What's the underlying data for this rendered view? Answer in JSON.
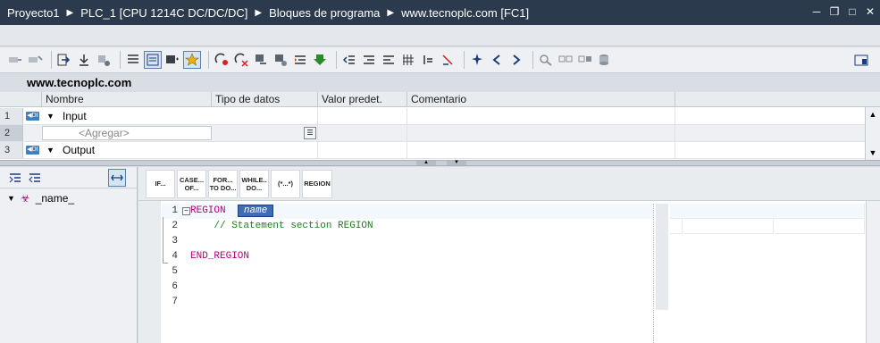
{
  "breadcrumb": [
    "Proyecto1",
    "PLC_1 [CPU 1214C DC/DC/DC]",
    "Bloques de programa",
    "www.tecnoplc.com [FC1]"
  ],
  "block_name": "www.tecnoplc.com",
  "interface": {
    "columns": [
      "Nombre",
      "Tipo de datos",
      "Valor predet.",
      "Comentario"
    ],
    "rows": [
      {
        "num": "1",
        "name": "Input"
      },
      {
        "num": "2",
        "placeholder": "<Agregar>"
      },
      {
        "num": "3",
        "name": "Output"
      }
    ]
  },
  "tree": {
    "node": "_name_"
  },
  "snippets": [
    {
      "l1": "IF...",
      "l2": ""
    },
    {
      "l1": "CASE...",
      "l2": "OF..."
    },
    {
      "l1": "FOR...",
      "l2": "TO DO..."
    },
    {
      "l1": "WHILE..",
      "l2": "DO..."
    },
    {
      "l1": "(*...*)",
      "l2": ""
    },
    {
      "l1": "REGION",
      "l2": ""
    }
  ],
  "code": {
    "lines": [
      "1",
      "2",
      "3",
      "4",
      "5",
      "6",
      "7"
    ],
    "region_kw": "REGION",
    "region_name": "name",
    "comment": "// Statement section REGION",
    "end_region": "END_REGION"
  },
  "colors": {
    "titlebar": "#2b3a4c",
    "keyword": "#b3007a",
    "comment": "#237a23",
    "highlight": "#3f6bb7"
  }
}
